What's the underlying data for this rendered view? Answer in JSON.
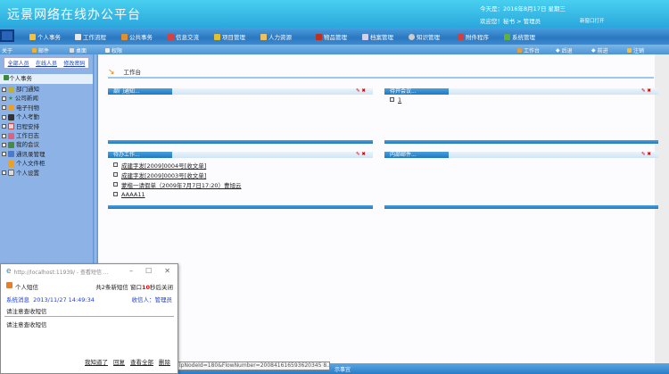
{
  "header": {
    "title": "远景网络在线办公平台",
    "date": "今天是：2016年8月17日  星期三",
    "welcome": "欢迎您！秘书 > 管理员",
    "new_window": "新窗口打开"
  },
  "nav": [
    "个人事务",
    "工作流程",
    "公共事务",
    "信息交流",
    "项目管理",
    "人力资源",
    "物品管理",
    "档案管理",
    "知识管理",
    "附件程序",
    "系统管理"
  ],
  "toolbar": {
    "left": [
      "关于",
      "邮件",
      "桌面",
      "权限"
    ],
    "right": [
      "工作台",
      "后退",
      "前进",
      "注销"
    ]
  },
  "sidebar": {
    "buttons": [
      "全部人员",
      "在线人员",
      "修改密码"
    ],
    "header": "个人事务",
    "items": [
      "部门通知",
      "公司新闻",
      "电子刊物",
      "个人考勤",
      "日程安排",
      "工作日志",
      "我的会议",
      "通讯录管理",
      "个人文件柜",
      "个人设置"
    ]
  },
  "main": {
    "workbench": "工作台",
    "panels": {
      "dept": "部门通知...",
      "meeting": "待开会议...",
      "todo": "待办工作...",
      "mail": "内部邮件..."
    },
    "meeting_items": [
      "1"
    ],
    "todo_items": [
      "成建字发[2009]0004号[收文单]",
      "成建字发[2009]0003号[收文单]",
      "蒙楷一请假单（2009年7月7日17:20）曹旭云",
      "AAAA11"
    ]
  },
  "status": {
    "tooltip": "lpNodeId=180&FlowNumber=200841616593620345 8...",
    "text": "示事宜"
  },
  "popup": {
    "title": "http://localhost:11939/ - 查看短信 ...",
    "heading": "个人短信",
    "count_pre": "共2条新短信 窗口",
    "count_num": "10",
    "count_post": "秒后关闭",
    "sender": "系统消息",
    "time": "2013/11/27 14:49:34",
    "recipient": "收信人：管理员",
    "subject": "请注意查收短信",
    "body": "请注意查收短信",
    "actions": [
      "我知道了",
      "回复",
      "查看全部",
      "删除"
    ]
  }
}
